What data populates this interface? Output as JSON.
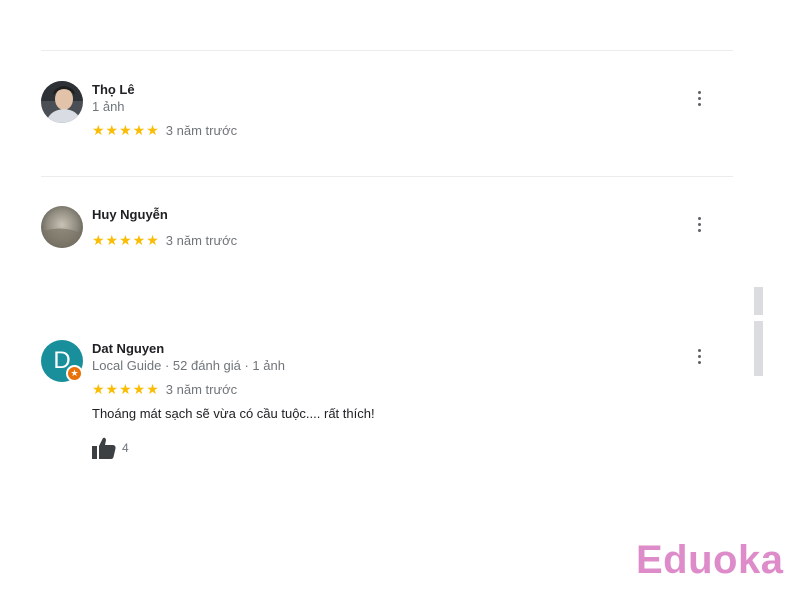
{
  "reviews": [
    {
      "name": "Thọ Lê",
      "meta": "1 ảnh",
      "stars": "★★★★★",
      "time": "3 năm trước",
      "avatar_icon": "user-photo"
    },
    {
      "name": "Huy Nguyễn",
      "stars": "★★★★★",
      "time": "3 năm trước",
      "avatar_icon": "user-photo"
    },
    {
      "name": "Dat Nguyen",
      "meta": "Local Guide · 52 đánh giá · 1 ảnh",
      "stars": "★★★★★",
      "time": "3 năm trước",
      "text": "Thoáng mát sạch sẽ vừa có cầu tuộc.... rất thích!",
      "avatar_letter": "D",
      "likes": "4",
      "like_icon": "thumbs-up-icon"
    }
  ],
  "more_icon": "more-vert-icon",
  "watermark": "Eduoka",
  "colors": {
    "star": "#fbbc04",
    "avatar_teal": "#1a8f9c",
    "local_guide_badge": "#e8710a",
    "watermark": "#de8cc9"
  }
}
